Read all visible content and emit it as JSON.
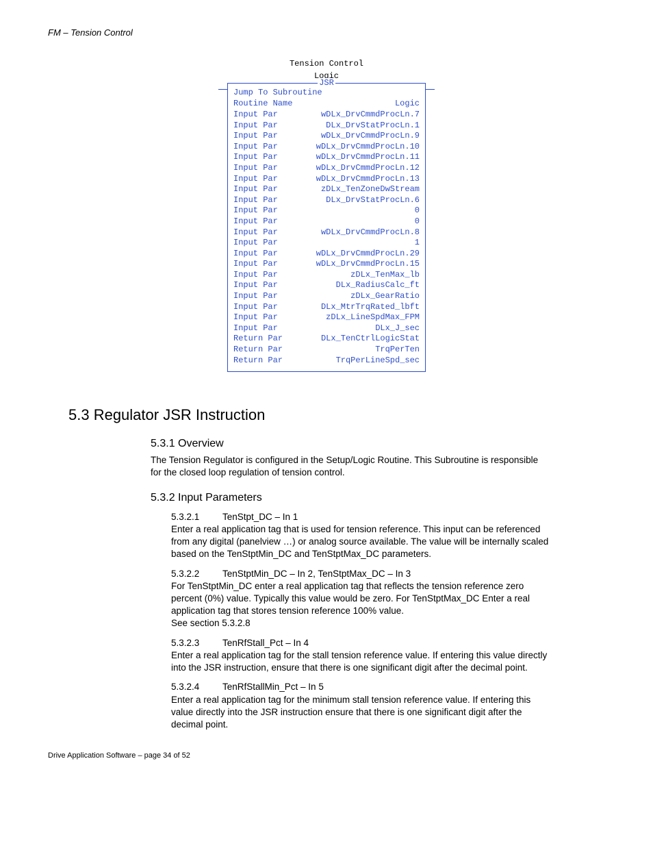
{
  "header": "FM – Tension Control",
  "jsr": {
    "title_lines": [
      "Tension Control",
      "Logic"
    ],
    "label": "JSR",
    "jump": "Jump To Subroutine",
    "routine_row": {
      "l": "Routine Name",
      "r": "Logic"
    },
    "rows": [
      {
        "l": "Input Par",
        "r": "wDLx_DrvCmmdProcLn.7"
      },
      {
        "l": "Input Par",
        "r": "DLx_DrvStatProcLn.1"
      },
      {
        "l": "Input Par",
        "r": "wDLx_DrvCmmdProcLn.9"
      },
      {
        "l": "Input Par",
        "r": "wDLx_DrvCmmdProcLn.10"
      },
      {
        "l": "Input Par",
        "r": "wDLx_DrvCmmdProcLn.11"
      },
      {
        "l": "Input Par",
        "r": "wDLx_DrvCmmdProcLn.12"
      },
      {
        "l": "Input Par",
        "r": "wDLx_DrvCmmdProcLn.13"
      },
      {
        "l": "Input Par",
        "r": "zDLx_TenZoneDwStream"
      },
      {
        "l": "Input Par",
        "r": "DLx_DrvStatProcLn.6"
      },
      {
        "l": "Input Par",
        "r": "0"
      },
      {
        "l": "Input Par",
        "r": "0"
      },
      {
        "l": "Input Par",
        "r": "wDLx_DrvCmmdProcLn.8"
      },
      {
        "l": "Input Par",
        "r": "1"
      },
      {
        "l": "Input Par",
        "r": "wDLx_DrvCmmdProcLn.29"
      },
      {
        "l": "Input Par",
        "r": "wDLx_DrvCmmdProcLn.15"
      },
      {
        "l": "Input Par",
        "r": "zDLx_TenMax_lb"
      },
      {
        "l": "Input Par",
        "r": "DLx_RadiusCalc_ft"
      },
      {
        "l": "Input Par",
        "r": "zDLx_GearRatio"
      },
      {
        "l": "Input Par",
        "r": "DLx_MtrTrqRated_lbft"
      },
      {
        "l": "Input Par",
        "r": "zDLx_LineSpdMax_FPM"
      },
      {
        "l": "Input Par",
        "r": "DLx_J_sec"
      },
      {
        "l": "Return Par",
        "r": "DLx_TenCtrlLogicStat"
      },
      {
        "l": "Return Par",
        "r": "TrqPerTen"
      },
      {
        "l": "Return Par",
        "r": "TrqPerLineSpd_sec"
      }
    ]
  },
  "section_5_3": {
    "title": "5.3  Regulator JSR Instruction",
    "s1": {
      "title": "5.3.1  Overview",
      "body": "The Tension Regulator is configured in the Setup/Logic Routine.  This Subroutine is responsible for the closed loop regulation of tension control."
    },
    "s2": {
      "title": "5.3.2  Input Parameters",
      "p1": {
        "num": "5.3.2.1",
        "name": "TenStpt_DC – In 1",
        "body": "Enter a real application tag that is used for tension reference.  This input can be referenced from any digital (panelview …) or analog source available.  The value will be internally scaled based on the TenStptMin_DC and TenStptMax_DC parameters."
      },
      "p2": {
        "num": "5.3.2.2",
        "name": "TenStptMin_DC – In 2, TenStptMax_DC – In 3",
        "body": "For TenStptMin_DC  enter a real application tag that reflects the tension reference zero percent (0%) value.  Typically this value would be zero.  For TenStptMax_DC Enter a real application tag that stores tension reference 100% value.",
        "extra": "See section 5.3.2.8"
      },
      "p3": {
        "num": "5.3.2.3",
        "name": "TenRfStall_Pct – In 4",
        "body": "Enter a real application tag for the stall tension reference value.  If entering this value directly into the JSR instruction, ensure that there is one significant digit after the decimal point."
      },
      "p4": {
        "num": "5.3.2.4",
        "name": "TenRfStallMin_Pct – In 5",
        "body": "Enter a real application tag for the minimum stall tension reference value.  If entering this value directly into the JSR instruction ensure that there is one significant digit after the decimal point."
      }
    }
  },
  "footer": "Drive Application Software – page 34 of 52"
}
